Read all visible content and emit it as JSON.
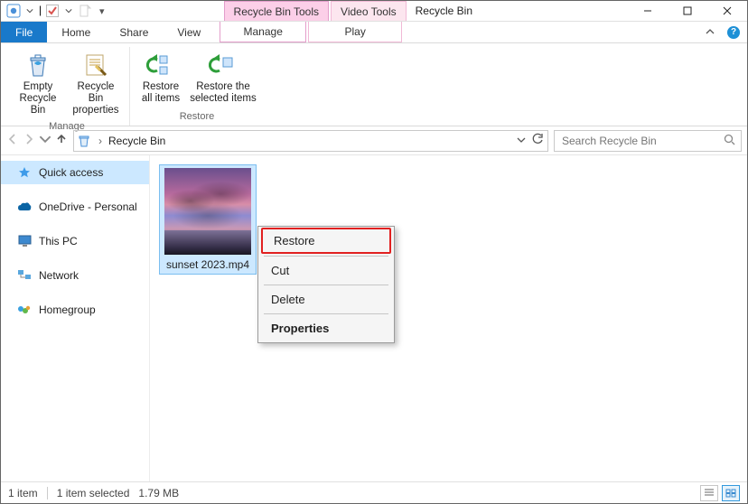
{
  "window": {
    "title": "Recycle Bin"
  },
  "titlebar": {
    "context_tabs": [
      {
        "label": "Recycle Bin Tools"
      },
      {
        "label": "Video Tools"
      }
    ]
  },
  "ribbon": {
    "tabs": {
      "file": "File",
      "home": "Home",
      "share": "Share",
      "view": "View",
      "manage": "Manage",
      "play": "Play"
    },
    "groups": {
      "manage": {
        "name": "Manage",
        "empty": "Empty\nRecycle Bin",
        "properties": "Recycle Bin\nproperties"
      },
      "restore": {
        "name": "Restore",
        "restore_all": "Restore\nall items",
        "restore_selected": "Restore the\nselected items"
      }
    }
  },
  "address": {
    "location": "Recycle Bin"
  },
  "search": {
    "placeholder": "Search Recycle Bin"
  },
  "sidebar": {
    "items": [
      {
        "label": "Quick access"
      },
      {
        "label": "OneDrive - Personal"
      },
      {
        "label": "This PC"
      },
      {
        "label": "Network"
      },
      {
        "label": "Homegroup"
      }
    ]
  },
  "files": [
    {
      "name": "sunset 2023.mp4"
    }
  ],
  "context_menu": {
    "restore": "Restore",
    "cut": "Cut",
    "delete": "Delete",
    "properties": "Properties"
  },
  "status": {
    "count": "1 item",
    "selected": "1 item selected",
    "size": "1.79 MB"
  }
}
